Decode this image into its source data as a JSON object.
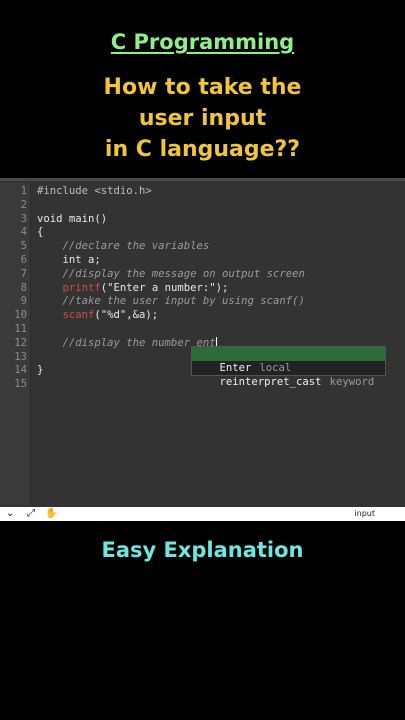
{
  "header": {
    "subject": "C Programming",
    "question_lines": [
      "How to take the",
      "user input",
      "in C language??"
    ]
  },
  "editor": {
    "lines": [
      {
        "n": "1",
        "tokens": [
          {
            "t": "#include <stdio.h>",
            "c": "pp"
          }
        ]
      },
      {
        "n": "2",
        "tokens": []
      },
      {
        "n": "3",
        "tokens": [
          {
            "t": "void main()",
            "c": ""
          }
        ]
      },
      {
        "n": "4",
        "tokens": [
          {
            "t": "{",
            "c": ""
          }
        ]
      },
      {
        "n": "5",
        "tokens": [
          {
            "t": "    //declare the variables",
            "c": "cm"
          }
        ]
      },
      {
        "n": "6",
        "tokens": [
          {
            "t": "    int a;",
            "c": ""
          }
        ]
      },
      {
        "n": "7",
        "tokens": [
          {
            "t": "    //display the message on output screen",
            "c": "cm"
          }
        ]
      },
      {
        "n": "8",
        "tokens": [
          {
            "t": "    ",
            "c": ""
          },
          {
            "t": "printf",
            "c": "fn"
          },
          {
            "t": "(\"Enter a number:\");",
            "c": ""
          }
        ]
      },
      {
        "n": "9",
        "tokens": [
          {
            "t": "    //take the user input by using scanf()",
            "c": "cm"
          }
        ]
      },
      {
        "n": "10",
        "tokens": [
          {
            "t": "    ",
            "c": ""
          },
          {
            "t": "scanf",
            "c": "fn"
          },
          {
            "t": "(\"%d\",&a);",
            "c": ""
          }
        ]
      },
      {
        "n": "11",
        "tokens": []
      },
      {
        "n": "12",
        "tokens": [
          {
            "t": "    //display the number ent",
            "c": "cm"
          }
        ]
      },
      {
        "n": "13",
        "tokens": []
      },
      {
        "n": "14",
        "tokens": [
          {
            "t": "}",
            "c": ""
          }
        ]
      },
      {
        "n": "15",
        "tokens": []
      }
    ],
    "autocomplete": [
      {
        "name": "Enter",
        "kind": "local",
        "selected": true
      },
      {
        "name": "reinterpret_cast",
        "kind": "keyword",
        "selected": false
      }
    ]
  },
  "statusbar": {
    "icons": [
      "chevron-down-icon",
      "expand-icon",
      "hand-icon"
    ],
    "mode": "input"
  },
  "footer": {
    "caption": "Easy Explanation"
  },
  "colors": {
    "subject": "#8ff08a",
    "question": "#f0c53c",
    "caption": "#6ee7e0",
    "function": "#c94f42",
    "autocomplete_selected": "#2e6b3a"
  }
}
